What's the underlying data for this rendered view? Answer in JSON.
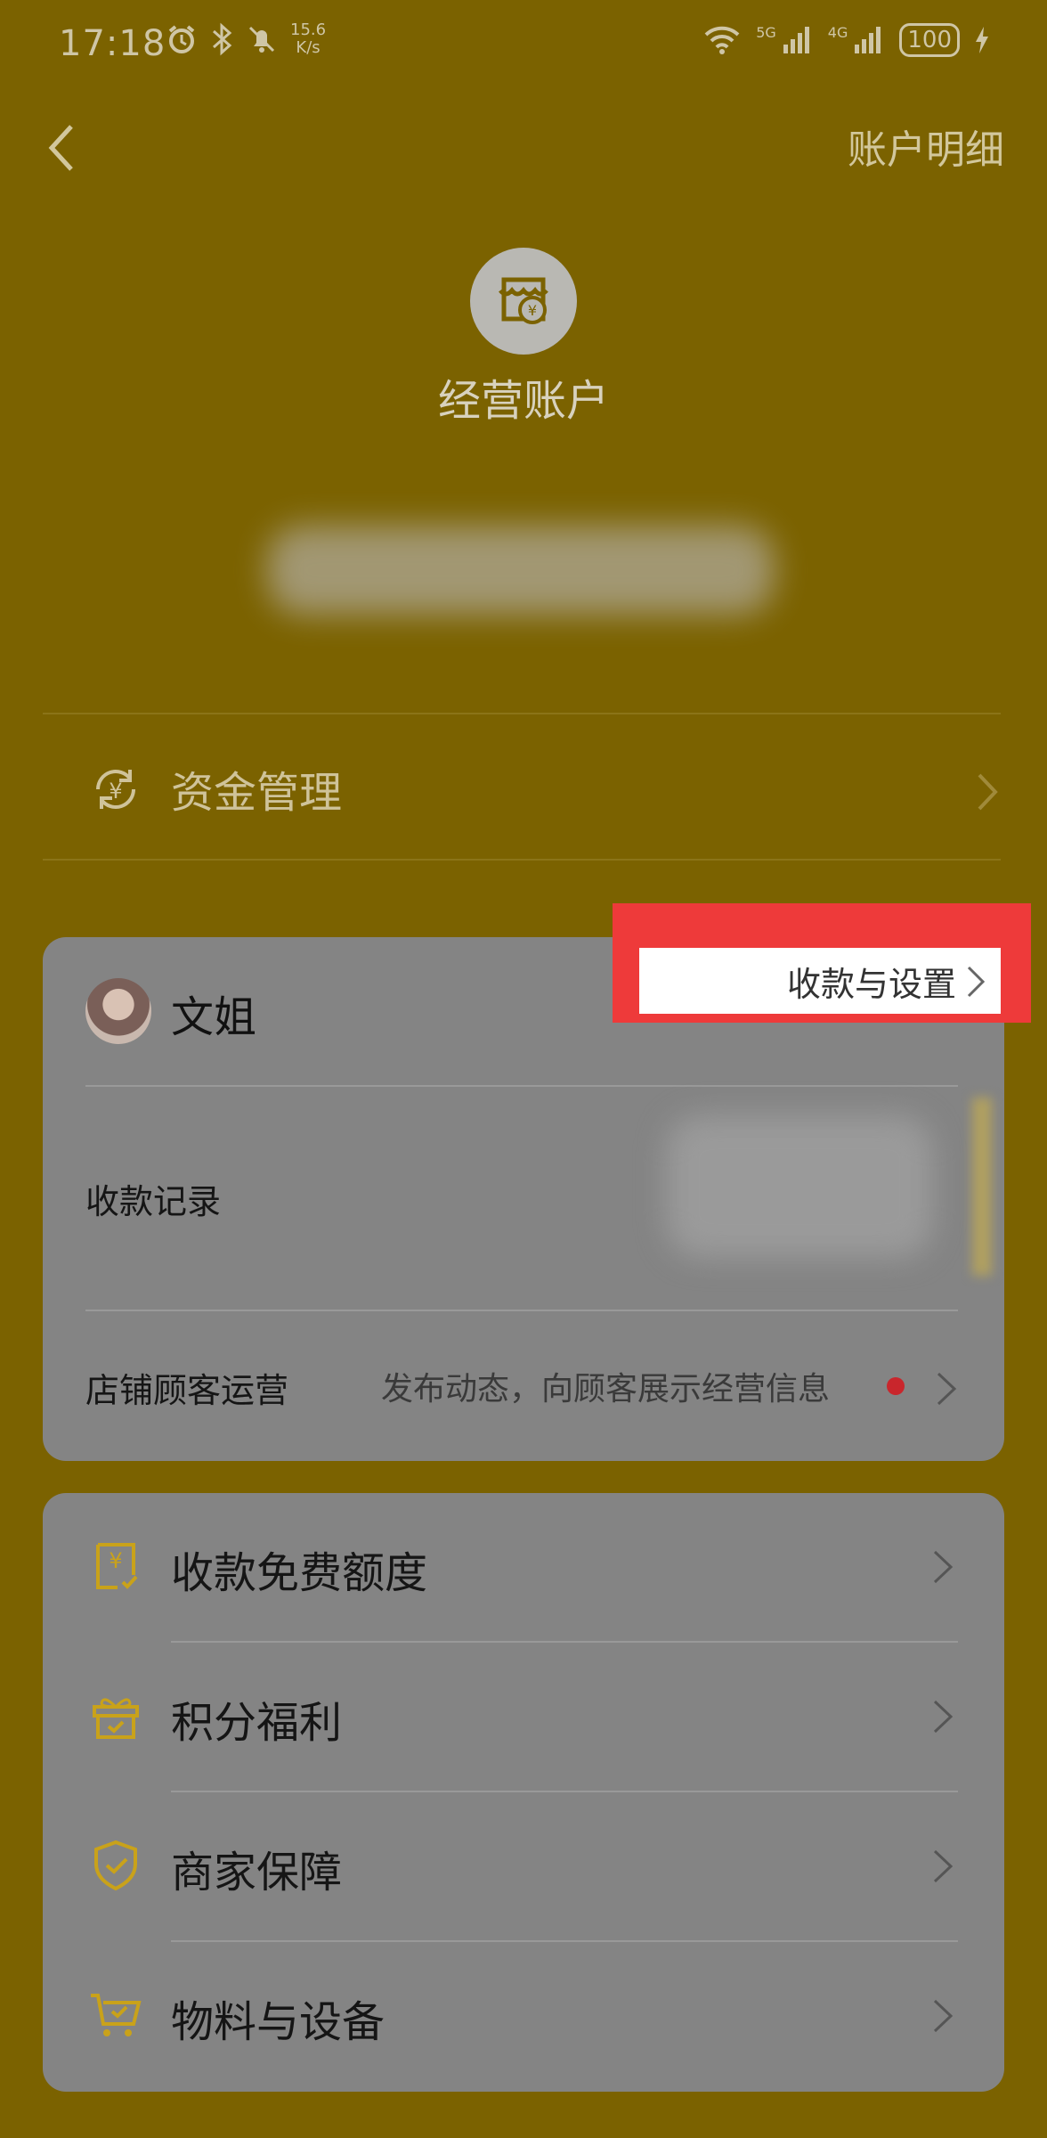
{
  "status_bar": {
    "time": "17:18",
    "net_speed_value": "15.6",
    "net_speed_unit": "K/s",
    "sim1_label": "5G",
    "sim2_label": "4G",
    "battery": "100"
  },
  "header": {
    "account_detail_label": "账户明细",
    "account_title": "经营账户"
  },
  "fund_management": {
    "label": "资金管理"
  },
  "merchant_card": {
    "name": "文姐",
    "settings_label": "收款与设置",
    "record_label": "收款记录",
    "ops_label": "店铺顾客运营",
    "ops_desc": "发布动态，向顾客展示经营信息"
  },
  "menu": [
    {
      "label": "收款免费额度",
      "icon": "receipt-icon"
    },
    {
      "label": "积分福利",
      "icon": "gift-icon"
    },
    {
      "label": "商家保障",
      "icon": "shield-icon"
    },
    {
      "label": "物料与设备",
      "icon": "cart-icon"
    }
  ],
  "colors": {
    "background": "#7b6200",
    "card": "#848484",
    "highlight": "#ee3a3a",
    "icon_accent": "#c9a21a",
    "dot": "#c9262c"
  }
}
